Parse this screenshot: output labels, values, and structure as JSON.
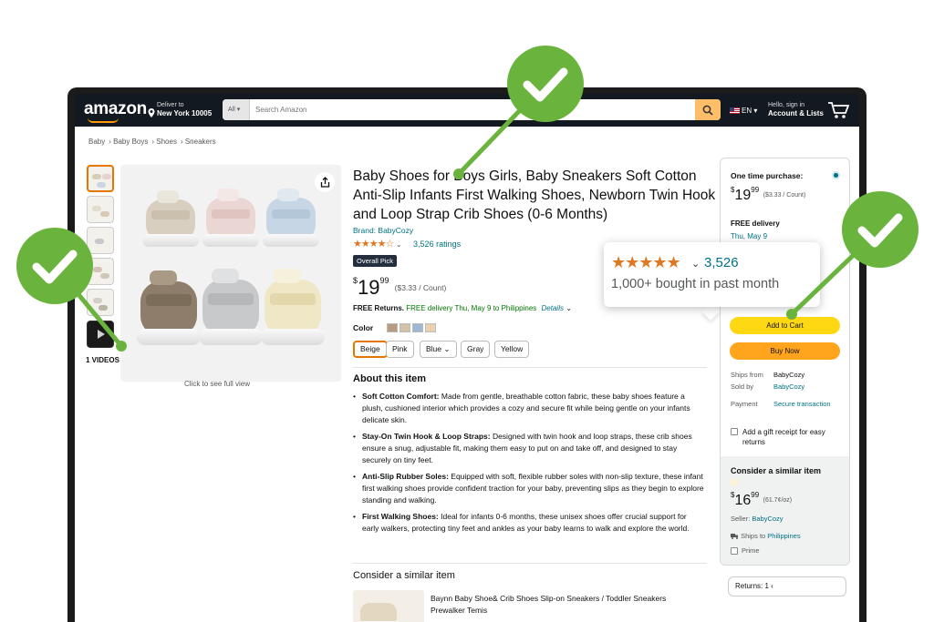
{
  "header": {
    "logo": "amazon",
    "deliver_line1": "Deliver to",
    "deliver_line2": "New York 10005",
    "search_category": "All",
    "search_placeholder": "Search Amazon",
    "lang": "EN",
    "account_line1": "Hello, sign in",
    "account_line2": "Account & Lists"
  },
  "breadcrumb": [
    "Baby",
    "Baby Boys",
    "Shoes",
    "Sneakers"
  ],
  "gallery": {
    "videos_label": "1 VIDEOS",
    "click_to_see": "Click to see full view"
  },
  "product": {
    "title": "Baby Shoes for Boys Girls, Baby Sneakers Soft Cotton Anti-Slip Infants First Walking Shoes, Newborn Twin Hook and Loop Strap Crib Shoes (0-6 Months)",
    "brand": "Brand: BabyCozy",
    "rating_count": "3,526 ratings",
    "badge": "Overall Pick",
    "price_whole": "19",
    "price_fraction": "99",
    "price_currency": "$",
    "price_per": "($3.33 / Count)",
    "returns_label": "FREE Returns.",
    "delivery_text": "FREE delivery Thu, May 9 to Philippines",
    "details_link": "Details",
    "color_label": "Color",
    "color_options": [
      "Beige",
      "Pink",
      "Blue",
      "Gray",
      "Yellow"
    ],
    "about_title": "About this item",
    "bullets": [
      {
        "head": "Soft Cotton Comfort:",
        "body": " Made from gentle, breathable cotton fabric, these baby shoes feature a plush, cushioned interior which provides a cozy and secure fit while being gentle on your infants delicate skin."
      },
      {
        "head": "Stay-On Twin Hook & Loop Straps:",
        "body": " Designed with twin hook and loop straps, these crib shoes ensure a snug, adjustable fit, making them easy to put on and take off, and designed to stay securely on tiny feet."
      },
      {
        "head": "Anti-Slip Rubber Soles:",
        "body": " Equipped with soft, flexible rubber soles with non-slip texture, these infant first walking shoes provide confident traction for your baby, preventing slips as they begin to explore standing and walking."
      },
      {
        "head": "First Walking Shoes:",
        "body": " Ideal for infants 0-6 months, these unisex shoes offer crucial support for early walkers, protecting tiny feet and ankles as your baby learns to walk and explore the world."
      }
    ],
    "similar_title": "Consider a similar item",
    "similar_item_title": "Baynn Baby Shoe& Crib Shoes Slip-on Sneakers / Toddler Sneakers Prewalker Temis"
  },
  "popup": {
    "count": "3,526",
    "bought": "1,000+ bought in past month"
  },
  "buybox": {
    "title": "One time purchase:",
    "price_currency": "$",
    "price_whole": "19",
    "price_fraction": "99",
    "price_per": "($3.33 / Count)",
    "free_delivery": "FREE delivery",
    "delivery_date": "Thu, May 9",
    "add_to_cart": "Add to Cart",
    "buy_now": "Buy Now",
    "ships_from_label": "Ships from",
    "ships_from_value": "BabyCozy",
    "sold_by_label": "Sold by",
    "sold_by_value": "BabyCozy",
    "payment_label": "Payment",
    "payment_value": "Secure transaction",
    "gift_receipt": "Add a gift receipt for easy returns",
    "consider_title": "Consider a similar item",
    "consider_price_whole": "16",
    "consider_price_fraction": "99",
    "consider_price_per": "(61.7¢/oz)",
    "consider_seller_label": "Seller:",
    "consider_seller": "BabyCozy",
    "ships_to_label": "Ships to",
    "ships_to_value": "Philippines",
    "prime": "Prime",
    "returns_label": "Returns:",
    "returns_value": "1"
  },
  "colors": {
    "header_bg": "#131921",
    "search_button": "#febd69",
    "add_to_cart": "#ffd814",
    "buy_now": "#ffa41c",
    "link": "#007185",
    "star": "#de7921",
    "check_green": "#6ab43e"
  },
  "overlay": {
    "check_marks": 3
  }
}
